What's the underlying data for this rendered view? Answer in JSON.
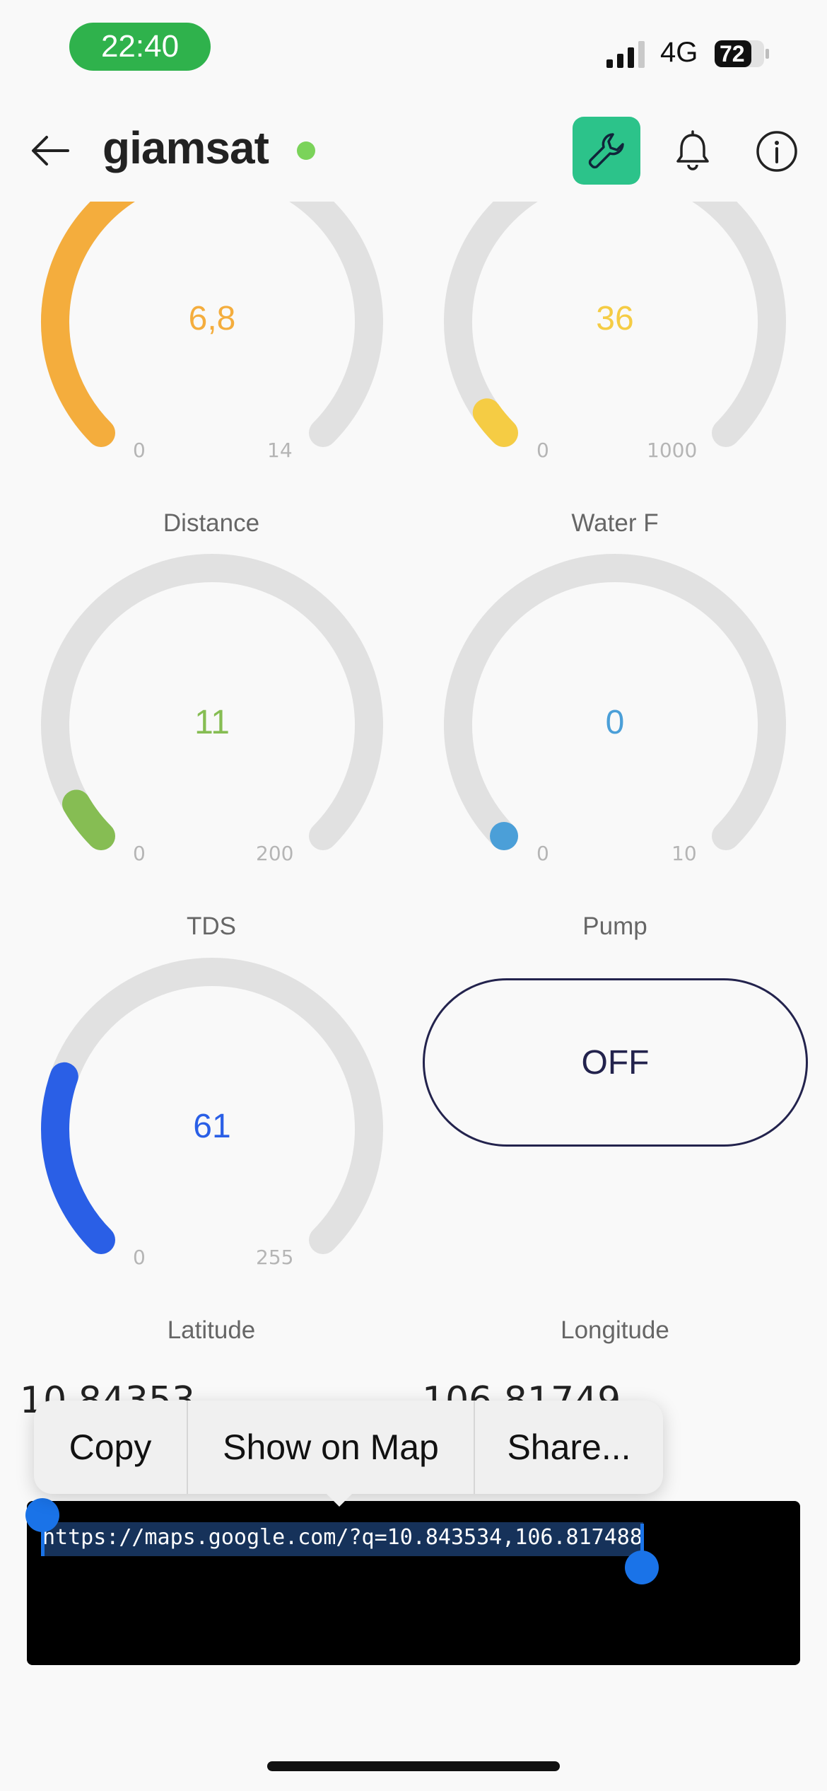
{
  "status_bar": {
    "time": "22:40",
    "network": "4G",
    "battery": "72"
  },
  "header": {
    "title": "giamsat"
  },
  "gauges": [
    {
      "label": "",
      "value": "6,8",
      "min": "0",
      "max": "14",
      "color": "#f4ad3d",
      "fraction": 0.486
    },
    {
      "label": "",
      "value": "36",
      "min": "0",
      "max": "1000",
      "color": "#f5cc44",
      "fraction": 0.036
    },
    {
      "label": "Distance",
      "value": "11",
      "min": "0",
      "max": "200",
      "color": "#86bd53",
      "fraction": 0.055
    },
    {
      "label": "Water F",
      "value": "0",
      "min": "0",
      "max": "10",
      "color": "#4b9fd8",
      "fraction": 0.0
    },
    {
      "label": "TDS",
      "value": "61",
      "min": "0",
      "max": "255",
      "color": "#2a5fe6",
      "fraction": 0.239
    }
  ],
  "pump": {
    "label": "Pump",
    "state": "OFF"
  },
  "coordinates": {
    "latitude_label": "Latitude",
    "latitude_value": "10.84353",
    "longitude_label": "Longitude",
    "longitude_value": "106.81749"
  },
  "context_menu": {
    "copy": "Copy",
    "show_on_map": "Show on Map",
    "share": "Share..."
  },
  "terminal": {
    "url": "https://maps.google.com/?q=10.843534,106.817488"
  }
}
